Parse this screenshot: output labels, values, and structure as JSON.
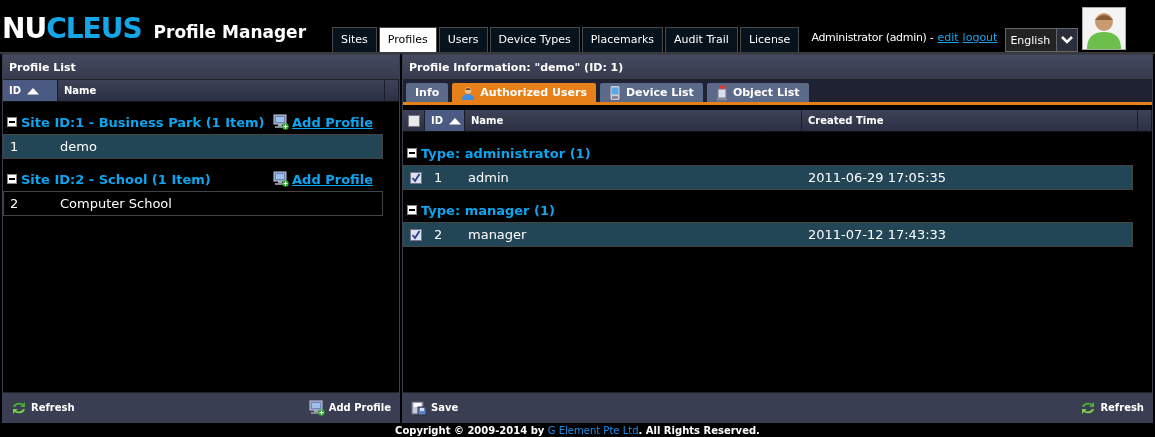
{
  "header": {
    "logo_first": "NU",
    "logo_second": "CLEUS",
    "title": "Profile Manager",
    "tabs": [
      {
        "label": "Sites",
        "selected": false
      },
      {
        "label": "Profiles",
        "selected": true
      },
      {
        "label": "Users",
        "selected": false
      },
      {
        "label": "Device Types",
        "selected": false
      },
      {
        "label": "Placemarks",
        "selected": false
      },
      {
        "label": "Audit Trail",
        "selected": false
      },
      {
        "label": "License",
        "selected": false
      }
    ],
    "user": "Administrator (admin) -",
    "edit_link": "edit",
    "logout_link": "logout",
    "language": "English"
  },
  "profile_list": {
    "title": "Profile List",
    "columns": [
      {
        "label": "ID",
        "sorted": true
      },
      {
        "label": "Name",
        "sorted": false
      }
    ],
    "groups": [
      {
        "label": "Site ID:1 - Business Park (1 Item)",
        "expanded": true,
        "action": "Add Profile",
        "rows": [
          {
            "id": "1",
            "name": "demo",
            "selected": true
          }
        ]
      },
      {
        "label": "Site ID:2 - School (1 Item)",
        "expanded": true,
        "action": "Add Profile",
        "rows": [
          {
            "id": "2",
            "name": "Computer School",
            "selected": false
          }
        ]
      }
    ],
    "toolbar": {
      "refresh": "Refresh",
      "add": "Add Profile"
    }
  },
  "profile_info": {
    "title": "Profile Information: \"demo\" (ID: 1)",
    "tabs": [
      {
        "label": "Info",
        "kind": "plain",
        "selected": false
      },
      {
        "label": "Authorized Users",
        "kind": "user",
        "selected": true
      },
      {
        "label": "Device List",
        "kind": "device",
        "selected": false
      },
      {
        "label": "Object List",
        "kind": "object",
        "selected": false
      }
    ],
    "select_all": {
      "checked": false
    },
    "columns": [
      {
        "label": "ID",
        "sorted": true
      },
      {
        "label": "Name",
        "sorted": false
      },
      {
        "label": "Created Time",
        "sorted": false
      }
    ],
    "groups": [
      {
        "label": "Type: administrator (1)",
        "expanded": true,
        "rows": [
          {
            "id": "1",
            "name": "admin",
            "created": "2011-06-29 17:05:35",
            "checked": true,
            "selected": true
          }
        ]
      },
      {
        "label": "Type: manager (1)",
        "expanded": true,
        "rows": [
          {
            "id": "2",
            "name": "manager",
            "created": "2011-07-12 17:43:33",
            "checked": true,
            "selected": true
          }
        ]
      }
    ],
    "toolbar": {
      "save": "Save",
      "refresh": "Refresh"
    }
  },
  "footer": {
    "text_before": "Copyright © 2009-2014 by ",
    "link": "G Element Pte Ltd",
    "text_after": ". All Rights Reserved."
  }
}
